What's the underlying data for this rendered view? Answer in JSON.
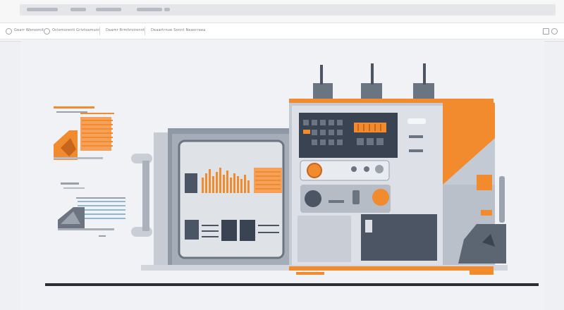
{
  "browser": {
    "tabs": [
      "",
      "",
      ""
    ],
    "address_items": [
      {
        "label": "Gearr Worsomit"
      },
      {
        "label": "Ociomsrenti Grivtsamunn"
      },
      {
        "label": "Daamr Rrmhroirennt"
      },
      {
        "label": "Deaartrnue Sonnt Neaorraea"
      }
    ]
  },
  "colors": {
    "accent": "#f28a2e",
    "machine_dark": "#4c5563",
    "machine_light": "#c9ced6",
    "panel_dark": "#3a4351",
    "ground": "#2a2d33"
  }
}
